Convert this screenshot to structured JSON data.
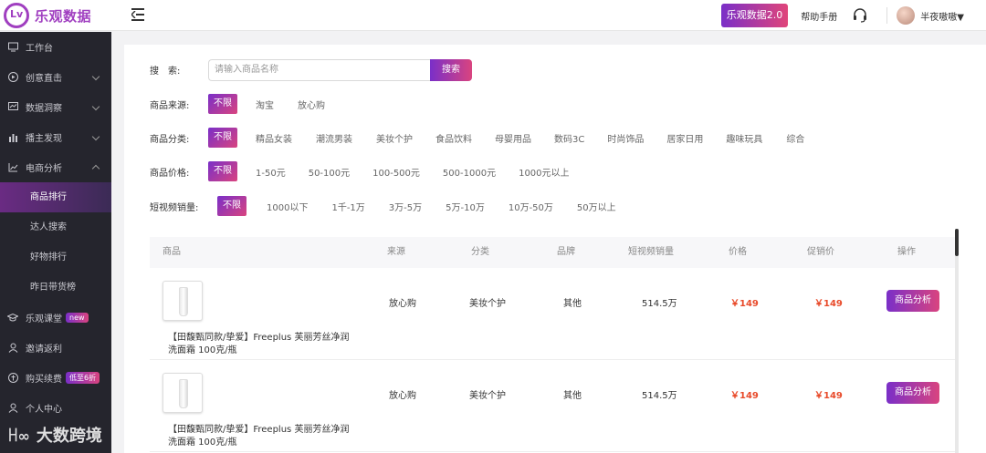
{
  "brand": {
    "name": "乐观数据",
    "mark": "Lv"
  },
  "topbar": {
    "version_label": "乐观数据2.0",
    "help_label": "帮助手册",
    "username": "半夜嗷嗷▼",
    "accent": "#a03fc0"
  },
  "sidebar": {
    "items": [
      {
        "label": "工作台",
        "icon": "monitor-icon"
      },
      {
        "label": "创意直击",
        "icon": "play-circle-icon"
      },
      {
        "label": "数据洞察",
        "icon": "chart-screen-icon"
      },
      {
        "label": "播主发现",
        "icon": "bar-chart-icon"
      },
      {
        "label": "电商分析",
        "icon": "line-chart-icon"
      }
    ],
    "sub_items": [
      "商品排行",
      "达人搜索",
      "好物排行",
      "昨日带货榜"
    ],
    "bottom_items": [
      {
        "label": "乐观课堂",
        "tag": "new",
        "icon": "graduation-cap-icon"
      },
      {
        "label": "邀请返利",
        "icon": "user-icon"
      },
      {
        "label": "购买续费",
        "tag": "低至6折",
        "icon": "coin-icon"
      },
      {
        "label": "个人中心",
        "icon": "person-icon"
      }
    ]
  },
  "search": {
    "label": "搜　索:",
    "placeholder": "请输入商品名称",
    "button": "搜索"
  },
  "filters": {
    "source": {
      "label": "商品来源:",
      "options": [
        "不限",
        "淘宝",
        "放心购"
      ]
    },
    "category": {
      "label": "商品分类:",
      "options": [
        "不限",
        "精品女装",
        "潮流男装",
        "美妆个护",
        "食品饮料",
        "母婴用品",
        "数码3C",
        "时尚饰品",
        "居家日用",
        "趣味玩具",
        "综合"
      ]
    },
    "price": {
      "label": "商品价格:",
      "options": [
        "不限",
        "1-50元",
        "50-100元",
        "100-500元",
        "500-1000元",
        "1000元以上"
      ]
    },
    "sales": {
      "label": "短视频销量:",
      "options": [
        "不限",
        "1000以下",
        "1千-1万",
        "3万-5万",
        "5万-10万",
        "10万-50万",
        "50万以上"
      ]
    }
  },
  "table": {
    "headers": [
      "商品",
      "来源",
      "分类",
      "品牌",
      "短视频销量",
      "价格",
      "促销价",
      "操作"
    ],
    "rows": [
      {
        "name": "【田馥甄同款/挚爱】Freeplus 芙丽芳丝净润洗面霜 100克/瓶",
        "source": "放心购",
        "category": "美妆个护",
        "brand": "其他",
        "sales": "514.5万",
        "price": "￥149",
        "promo_price": "￥149",
        "action": "商品分析"
      },
      {
        "name": "【田馥甄同款/挚爱】Freeplus 芙丽芳丝净润洗面霜 100克/瓶",
        "source": "放心购",
        "category": "美妆个护",
        "brand": "其他",
        "sales": "514.5万",
        "price": "￥149",
        "promo_price": "￥149",
        "action": "商品分析"
      }
    ]
  },
  "watermark": {
    "mark": "ꀿ∞",
    "text": "大数跨境"
  }
}
